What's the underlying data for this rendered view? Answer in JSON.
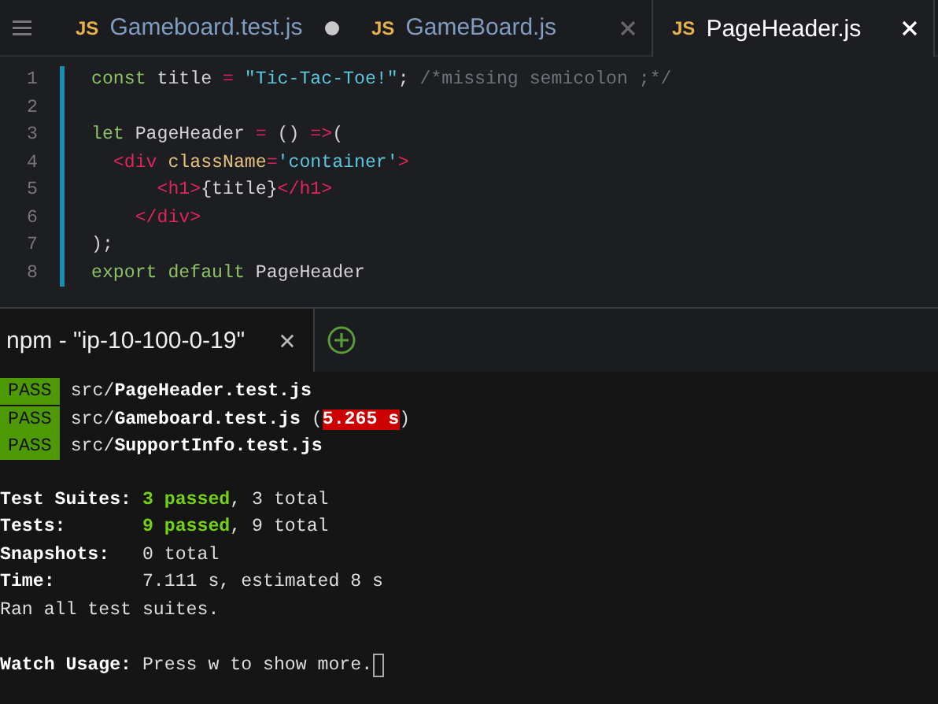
{
  "editor_tabs": [
    {
      "label": "Gameboard.test.js",
      "badge": "JS",
      "selected": false,
      "modified": true
    },
    {
      "label": "GameBoard.js",
      "badge": "JS",
      "selected": false,
      "modified": false
    },
    {
      "label": "PageHeader.js",
      "badge": "JS",
      "selected": true,
      "modified": false
    }
  ],
  "code_lines": [
    {
      "number": "1",
      "tokens": [
        {
          "kind": "keyword",
          "text": "const "
        },
        {
          "kind": "plain",
          "text": "title "
        },
        {
          "kind": "operator",
          "text": "= "
        },
        {
          "kind": "string",
          "text": "\"Tic-Tac-Toe!\""
        },
        {
          "kind": "plain",
          "text": "; "
        },
        {
          "kind": "comment",
          "text": "/*missing semicolon ;*/"
        }
      ]
    },
    {
      "number": "2"
    },
    {
      "number": "3",
      "tokens": [
        {
          "kind": "keyword",
          "text": "let "
        },
        {
          "kind": "plain",
          "text": "PageHeader "
        },
        {
          "kind": "operator",
          "text": "= "
        },
        {
          "kind": "plain",
          "text": "() "
        },
        {
          "kind": "operator",
          "text": "=>"
        },
        {
          "kind": "plain",
          "text": "("
        }
      ]
    },
    {
      "number": "4",
      "tokens": [
        {
          "kind": "tag",
          "text": "  <div "
        },
        {
          "kind": "attr",
          "text": "className"
        },
        {
          "kind": "operator",
          "text": "="
        },
        {
          "kind": "string",
          "text": "'container'"
        },
        {
          "kind": "tag",
          "text": ">"
        }
      ]
    },
    {
      "number": "5",
      "tokens": [
        {
          "kind": "tag",
          "text": "      <h1>"
        },
        {
          "kind": "plain",
          "text": "{title}"
        },
        {
          "kind": "tag",
          "text": "</h1>"
        }
      ]
    },
    {
      "number": "6",
      "tokens": [
        {
          "kind": "tag",
          "text": "    </div>"
        }
      ]
    },
    {
      "number": "7",
      "tokens": [
        {
          "kind": "plain",
          "text": ");"
        }
      ]
    },
    {
      "number": "8",
      "tokens": [
        {
          "kind": "keyword",
          "text": "export default "
        },
        {
          "kind": "plain",
          "text": "PageHeader"
        }
      ]
    }
  ],
  "terminal_tabs": [
    {
      "label": "npm - \"ip-10-100-0-19\"",
      "selected": true
    }
  ],
  "test_results": [
    {
      "status": "PASS",
      "tokens": [
        {
          "kind": "plain",
          "text": "src/"
        },
        {
          "kind": "bold",
          "text": "PageHeader.test.js"
        }
      ]
    },
    {
      "status": "PASS",
      "tokens": [
        {
          "kind": "plain",
          "text": "src/"
        },
        {
          "kind": "bold",
          "text": "Gameboard.test.js"
        },
        {
          "kind": "plain",
          "text": " ("
        },
        {
          "kind": "slow",
          "text": "5.265 s"
        },
        {
          "kind": "plain",
          "text": ")"
        }
      ]
    },
    {
      "status": "PASS",
      "tokens": [
        {
          "kind": "plain",
          "text": "src/"
        },
        {
          "kind": "bold",
          "text": "SupportInfo.test.js"
        }
      ]
    }
  ],
  "summary_lines": [
    {
      "tokens": [
        {
          "kind": "bold",
          "text": "Test Suites: "
        },
        {
          "kind": "green",
          "text": "3 passed"
        },
        {
          "kind": "plain",
          "text": ", 3 total"
        }
      ]
    },
    {
      "tokens": [
        {
          "kind": "bold",
          "text": "Tests:       "
        },
        {
          "kind": "green",
          "text": "9 passed"
        },
        {
          "kind": "plain",
          "text": ", 9 total"
        }
      ]
    },
    {
      "tokens": [
        {
          "kind": "bold",
          "text": "Snapshots:   "
        },
        {
          "kind": "plain",
          "text": "0 total"
        }
      ]
    },
    {
      "tokens": [
        {
          "kind": "bold",
          "text": "Time:        "
        },
        {
          "kind": "plain",
          "text": "7.111 s, estimated 8 s"
        }
      ]
    },
    {
      "tokens": [
        {
          "kind": "plain",
          "text": "Ran all test suites."
        }
      ]
    },
    {
      "tokens": [
        {
          "kind": "bold",
          "text": "Watch Usage: "
        },
        {
          "kind": "plain",
          "text": "Press w to show more."
        }
      ],
      "blank_before": true,
      "cursor": true
    }
  ]
}
